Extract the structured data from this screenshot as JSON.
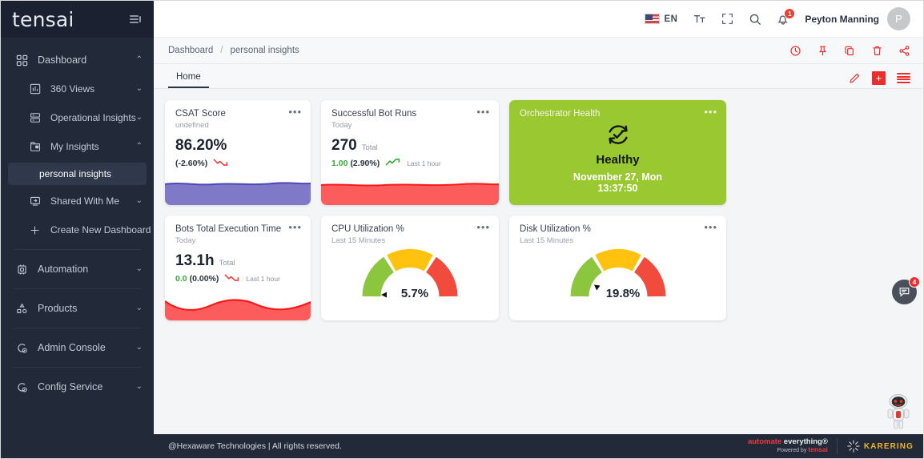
{
  "brand": {
    "name": "tensai",
    "collapse_icon": "collapse-menu-icon"
  },
  "sidebar": {
    "items": [
      {
        "label": "Dashboard",
        "icon": "dashboard-grid-icon",
        "chevron": "⌃",
        "level": 1
      },
      {
        "label": "360 Views",
        "icon": "bar-chart-icon",
        "chevron": "⌄",
        "level": 2
      },
      {
        "label": "Operational Insights",
        "icon": "layers-icon",
        "chevron": "⌄",
        "level": 2
      },
      {
        "label": "My Insights",
        "icon": "folder-image-icon",
        "chevron": "⌃",
        "level": 2
      },
      {
        "label": "Shared With Me",
        "icon": "shared-screen-icon",
        "chevron": "⌄",
        "level": 2
      },
      {
        "label": "Create New Dashboard",
        "icon": "plus-icon",
        "chevron": "",
        "level": 2
      }
    ],
    "active_sub": "personal insights",
    "groups": [
      {
        "label": "Automation",
        "icon": "automation-chip-icon",
        "chevron": "⌄"
      },
      {
        "label": "Products",
        "icon": "products-shapes-icon",
        "chevron": "⌄"
      },
      {
        "label": "Admin Console",
        "icon": "admin-gear-icon",
        "chevron": "⌄"
      },
      {
        "label": "Config Service",
        "icon": "config-gear-icon",
        "chevron": "⌄"
      }
    ]
  },
  "header": {
    "flag": "us-flag-icon",
    "language": "EN",
    "font_size_icon": "text-size-icon",
    "fullscreen_icon": "fullscreen-icon",
    "search_icon": "search-icon",
    "notification_icon": "bell-icon",
    "notification_count": "1",
    "user_name": "Peyton Manning",
    "avatar_initial": "P"
  },
  "breadcrumb": {
    "root": "Dashboard",
    "separator": "/",
    "current": "personal insights",
    "actions": [
      {
        "name": "history-clock-icon"
      },
      {
        "name": "pin-icon"
      },
      {
        "name": "copy-icon"
      },
      {
        "name": "delete-trash-icon"
      },
      {
        "name": "share-icon"
      }
    ]
  },
  "tabs": {
    "items": [
      {
        "label": "Home",
        "active": true
      }
    ],
    "actions": [
      {
        "name": "edit-pencil-icon"
      },
      {
        "name": "add-widget-button",
        "label": "+"
      },
      {
        "name": "list-view-icon"
      }
    ]
  },
  "cards": [
    {
      "id": "csat-score",
      "title": "CSAT Score",
      "subtitle": "undefined",
      "value": "86.20%",
      "unit": "",
      "delta": "(-2.60%)",
      "delta_dir": "down",
      "note": "",
      "menu": "•••",
      "spark_color": "#8079c8",
      "spark_stroke": "#4f46b8"
    },
    {
      "id": "successful-bot-runs",
      "title": "Successful Bot Runs",
      "subtitle": "Today",
      "value": "270",
      "unit": "Total",
      "delta_value": "1.00",
      "delta": "(2.90%)",
      "delta_dir": "up",
      "note": "Last 1 hour",
      "menu": "•••",
      "spark_color": "#fc5c5c",
      "spark_stroke": "#f51a1a"
    },
    {
      "id": "orchestrator-health",
      "title": "Orchestrator Health",
      "status": "Healthy",
      "date": "November 27, Mon",
      "time": "13:37:50",
      "menu": "•••",
      "bg": "#9ac831",
      "icon": "health-check-refresh-icon"
    },
    {
      "id": "bots-total-execution-time",
      "title": "Bots Total Execution Time",
      "subtitle": "Today",
      "value": "13.1h",
      "unit": "Total",
      "delta_value": "0.0",
      "delta": "(0.00%)",
      "delta_dir": "down",
      "note": "Last 1 hour",
      "menu": "•••",
      "spark_color": "#fc5c5c",
      "spark_stroke": "#f51a1a"
    },
    {
      "id": "cpu-utilization",
      "title": "CPU Utilization %",
      "subtitle": "Last 15 Minutes",
      "gauge_value": "5.7%",
      "gauge_percent": 5.7,
      "menu": "•••"
    },
    {
      "id": "disk-utilization",
      "title": "Disk Utilization %",
      "subtitle": "Last 15 Minutes",
      "gauge_value": "19.8%",
      "gauge_percent": 19.8,
      "menu": "•••"
    }
  ],
  "gauge_colors": {
    "low": "#8CC63E",
    "mid": "#FFC20E",
    "high": "#F04B3C"
  },
  "floating": {
    "chat_icon": "chat-feedback-icon",
    "chat_count": "4",
    "assistant_icon": "robot-assistant-icon"
  },
  "footer": {
    "copyright": "@Hexaware Technologies | All rights reserved.",
    "tagline_1": "automate",
    "tagline_2": " everything®",
    "powered_by": "Powered by",
    "powered_brand": "tensai",
    "partner": "KARERING"
  }
}
